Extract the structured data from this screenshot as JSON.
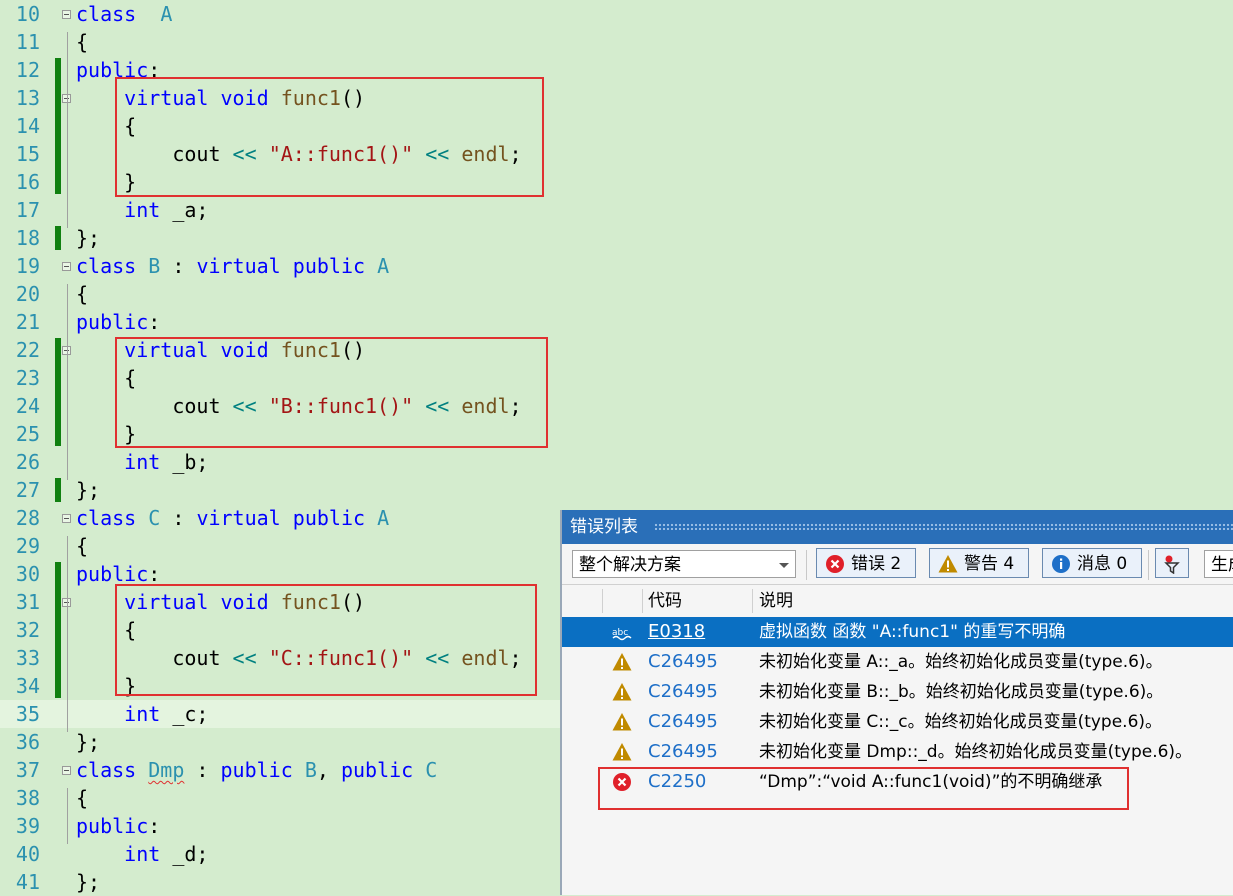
{
  "editor": {
    "lines": [
      {
        "n": "10",
        "tokens": [
          [
            "kw",
            "class"
          ],
          [
            "",
            "  "
          ],
          [
            "ty",
            "A"
          ]
        ]
      },
      {
        "n": "11",
        "tokens": [
          [
            "",
            "{"
          ]
        ]
      },
      {
        "n": "12",
        "tokens": [
          [
            "kw",
            "public"
          ],
          [
            "",
            ":"
          ]
        ]
      },
      {
        "n": "13",
        "tokens": [
          [
            "",
            "    "
          ],
          [
            "kw",
            "virtual"
          ],
          [
            "",
            ""
          ],
          [
            "kw",
            " void"
          ],
          [
            "",
            " "
          ],
          [
            "fn",
            "func1"
          ],
          [
            "",
            "()"
          ]
        ]
      },
      {
        "n": "14",
        "tokens": [
          [
            "",
            "    {"
          ]
        ]
      },
      {
        "n": "15",
        "tokens": [
          [
            "",
            "        cout "
          ],
          [
            "op",
            "<<"
          ],
          [
            "",
            " "
          ],
          [
            "str",
            "\"A::func1()\""
          ],
          [
            "",
            " "
          ],
          [
            "op",
            "<<"
          ],
          [
            "",
            " "
          ],
          [
            "fn",
            "endl"
          ],
          [
            "",
            ";"
          ]
        ]
      },
      {
        "n": "16",
        "tokens": [
          [
            "",
            "    }"
          ]
        ]
      },
      {
        "n": "17",
        "tokens": [
          [
            "",
            "    "
          ],
          [
            "kw",
            "int"
          ],
          [
            "",
            " _a;"
          ]
        ]
      },
      {
        "n": "18",
        "tokens": [
          [
            "",
            "};"
          ]
        ]
      },
      {
        "n": "19",
        "tokens": [
          [
            "kw",
            "class"
          ],
          [
            "",
            " "
          ],
          [
            "ty",
            "B"
          ],
          [
            "",
            " : "
          ],
          [
            "kw",
            "virtual"
          ],
          [
            "",
            " "
          ],
          [
            "kw",
            "public"
          ],
          [
            "",
            " "
          ],
          [
            "ty",
            "A"
          ]
        ]
      },
      {
        "n": "20",
        "tokens": [
          [
            "",
            "{"
          ]
        ]
      },
      {
        "n": "21",
        "tokens": [
          [
            "kw",
            "public"
          ],
          [
            "",
            ":"
          ]
        ]
      },
      {
        "n": "22",
        "tokens": [
          [
            "",
            "    "
          ],
          [
            "kw",
            "virtual"
          ],
          [
            "",
            " "
          ],
          [
            "kw",
            "void"
          ],
          [
            "",
            " "
          ],
          [
            "fn",
            "func1"
          ],
          [
            "",
            "()"
          ]
        ]
      },
      {
        "n": "23",
        "tokens": [
          [
            "",
            "    {"
          ]
        ]
      },
      {
        "n": "24",
        "tokens": [
          [
            "",
            "        cout "
          ],
          [
            "op",
            "<<"
          ],
          [
            "",
            " "
          ],
          [
            "str",
            "\"B::func1()\""
          ],
          [
            "",
            " "
          ],
          [
            "op",
            "<<"
          ],
          [
            "",
            " "
          ],
          [
            "fn",
            "endl"
          ],
          [
            "",
            ";"
          ]
        ]
      },
      {
        "n": "25",
        "tokens": [
          [
            "",
            "    }"
          ]
        ]
      },
      {
        "n": "26",
        "tokens": [
          [
            "",
            "    "
          ],
          [
            "kw",
            "int"
          ],
          [
            "",
            " _b;"
          ]
        ]
      },
      {
        "n": "27",
        "tokens": [
          [
            "",
            "};"
          ]
        ]
      },
      {
        "n": "28",
        "tokens": [
          [
            "kw",
            "class"
          ],
          [
            "",
            " "
          ],
          [
            "ty",
            "C"
          ],
          [
            "",
            " : "
          ],
          [
            "kw",
            "virtual"
          ],
          [
            "",
            " "
          ],
          [
            "kw",
            "public"
          ],
          [
            "",
            " "
          ],
          [
            "ty",
            "A"
          ]
        ]
      },
      {
        "n": "29",
        "tokens": [
          [
            "",
            "{"
          ]
        ]
      },
      {
        "n": "30",
        "tokens": [
          [
            "kw",
            "public"
          ],
          [
            "",
            ":"
          ]
        ]
      },
      {
        "n": "31",
        "tokens": [
          [
            "",
            "    "
          ],
          [
            "kw",
            "virtual"
          ],
          [
            "",
            " "
          ],
          [
            "kw",
            "void"
          ],
          [
            "",
            " "
          ],
          [
            "fn",
            "func1"
          ],
          [
            "",
            "()"
          ]
        ]
      },
      {
        "n": "32",
        "tokens": [
          [
            "",
            "    {"
          ]
        ]
      },
      {
        "n": "33",
        "tokens": [
          [
            "",
            "        cout "
          ],
          [
            "op",
            "<<"
          ],
          [
            "",
            " "
          ],
          [
            "str",
            "\"C::func1()\""
          ],
          [
            "",
            " "
          ],
          [
            "op",
            "<<"
          ],
          [
            "",
            " "
          ],
          [
            "fn",
            "endl"
          ],
          [
            "",
            ";"
          ]
        ]
      },
      {
        "n": "34",
        "tokens": [
          [
            "",
            "    }"
          ]
        ]
      },
      {
        "n": "35",
        "tokens": [
          [
            "",
            "    "
          ],
          [
            "kw",
            "int"
          ],
          [
            "",
            " _c;"
          ]
        ]
      },
      {
        "n": "36",
        "tokens": [
          [
            "",
            "};"
          ]
        ]
      },
      {
        "n": "37",
        "tokens": [
          [
            "kw",
            "class"
          ],
          [
            "",
            " "
          ],
          [
            "ty squig",
            "Dmp"
          ],
          [
            "",
            " : "
          ],
          [
            "kw",
            "public"
          ],
          [
            "",
            " "
          ],
          [
            "ty",
            "B"
          ],
          [
            "",
            ", "
          ],
          [
            "kw",
            "public"
          ],
          [
            "",
            " "
          ],
          [
            "ty",
            "C"
          ]
        ]
      },
      {
        "n": "38",
        "tokens": [
          [
            "",
            "{"
          ]
        ]
      },
      {
        "n": "39",
        "tokens": [
          [
            "kw",
            "public"
          ],
          [
            "",
            ":"
          ]
        ]
      },
      {
        "n": "40",
        "tokens": [
          [
            "",
            "    "
          ],
          [
            "kw",
            "int"
          ],
          [
            "",
            " _d;"
          ]
        ]
      },
      {
        "n": "41",
        "tokens": [
          [
            "",
            "};"
          ]
        ]
      }
    ]
  },
  "error_list": {
    "title": "错误列表",
    "scope": "整个解决方案",
    "errors_label": "错误 2",
    "warnings_label": "警告 4",
    "messages_label": "消息 0",
    "build_label": "生成",
    "col_code": "代码",
    "col_desc": "说明",
    "rows": [
      {
        "icon": "intellisense-icon",
        "code": "E0318",
        "desc": "虚拟函数 函数 \"A::func1\" 的重写不明确"
      },
      {
        "icon": "warning-icon",
        "code": "C26495",
        "desc": "未初始化变量 A::_a。始终初始化成员变量(type.6)。"
      },
      {
        "icon": "warning-icon",
        "code": "C26495",
        "desc": "未初始化变量 B::_b。始终初始化成员变量(type.6)。"
      },
      {
        "icon": "warning-icon",
        "code": "C26495",
        "desc": "未初始化变量 C::_c。始终初始化成员变量(type.6)。"
      },
      {
        "icon": "warning-icon",
        "code": "C26495",
        "desc": "未初始化变量 Dmp::_d。始终初始化成员变量(type.6)。"
      },
      {
        "icon": "error-icon",
        "code": "C2250",
        "desc": "“Dmp”:“void A::func1(void)”的不明确继承"
      }
    ]
  },
  "colors": {
    "error": "#e0202a",
    "warning": "#c08a00",
    "info": "#1e6fc8",
    "selection": "#0a6fc2"
  }
}
